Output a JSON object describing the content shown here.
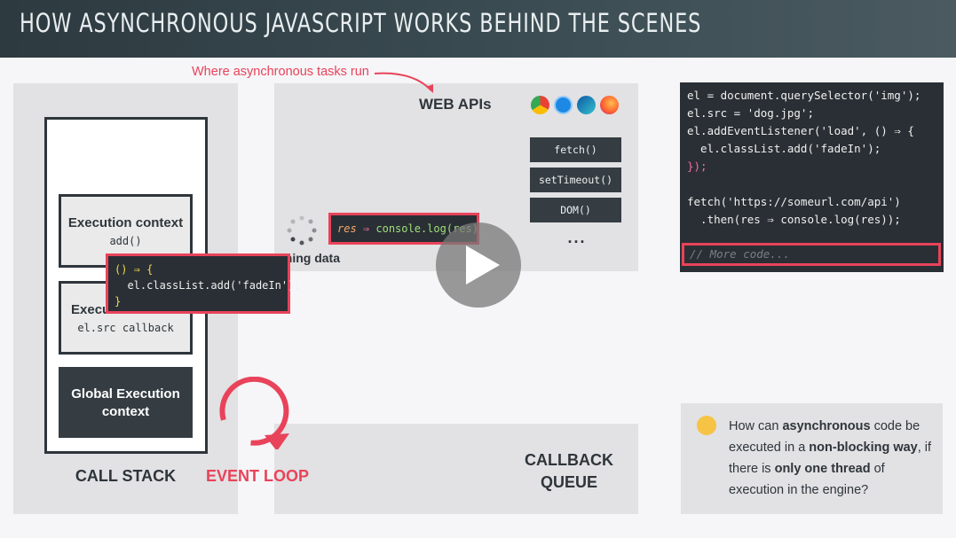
{
  "header": {
    "title": "How Asynchronous JavaScript Works Behind the Scenes"
  },
  "annotation": {
    "text": "Where asynchronous tasks run"
  },
  "web_apis": {
    "title": "WEB APIs",
    "browser_icons": [
      "chrome-icon",
      "safari-icon",
      "edge-icon",
      "firefox-icon"
    ],
    "apis": [
      "fetch()",
      "setTimeout()",
      "DOM()",
      "..."
    ]
  },
  "call_stack": {
    "label": "CALL STACK",
    "contexts": [
      {
        "title": "Execution context",
        "sub": "add()"
      },
      {
        "title": "Execu",
        "sub": "el.src callback"
      },
      {
        "title": "Global Execution context",
        "sub": ""
      }
    ]
  },
  "event_loop": {
    "label": "EVENT LOOP"
  },
  "callback_queue": {
    "label_line1": "CALLBACK",
    "label_line2": "QUEUE"
  },
  "callback_box": {
    "line1": "() ⇒ {",
    "line2": "  el.classList.add('fadeIn');",
    "line3": "}"
  },
  "res_box": {
    "text_res": "res",
    "text_arrow": " ⇒ ",
    "text_call": "console.log(res)"
  },
  "fetching": {
    "label": "Fetching data"
  },
  "code": {
    "lines": [
      "el = document.querySelector('img');",
      "el.src = 'dog.jpg';",
      "el.addEventListener('load', () ⇒ {",
      "  el.classList.add('fadeIn');",
      "});",
      "",
      "fetch('https://someurl.com/api')",
      "  .then(res ⇒ console.log(res));"
    ],
    "more": "// More code..."
  },
  "question": {
    "p1": "How can ",
    "b1": "asynchronous",
    "p2": " code be executed in a ",
    "b2": "non-blocking way",
    "p3": ", if there is ",
    "b3": "only one thread",
    "p4": " of execution in the engine?"
  },
  "colors": {
    "accent": "#e8435a",
    "dark": "#353d43",
    "panel": "#e2e1e3"
  }
}
